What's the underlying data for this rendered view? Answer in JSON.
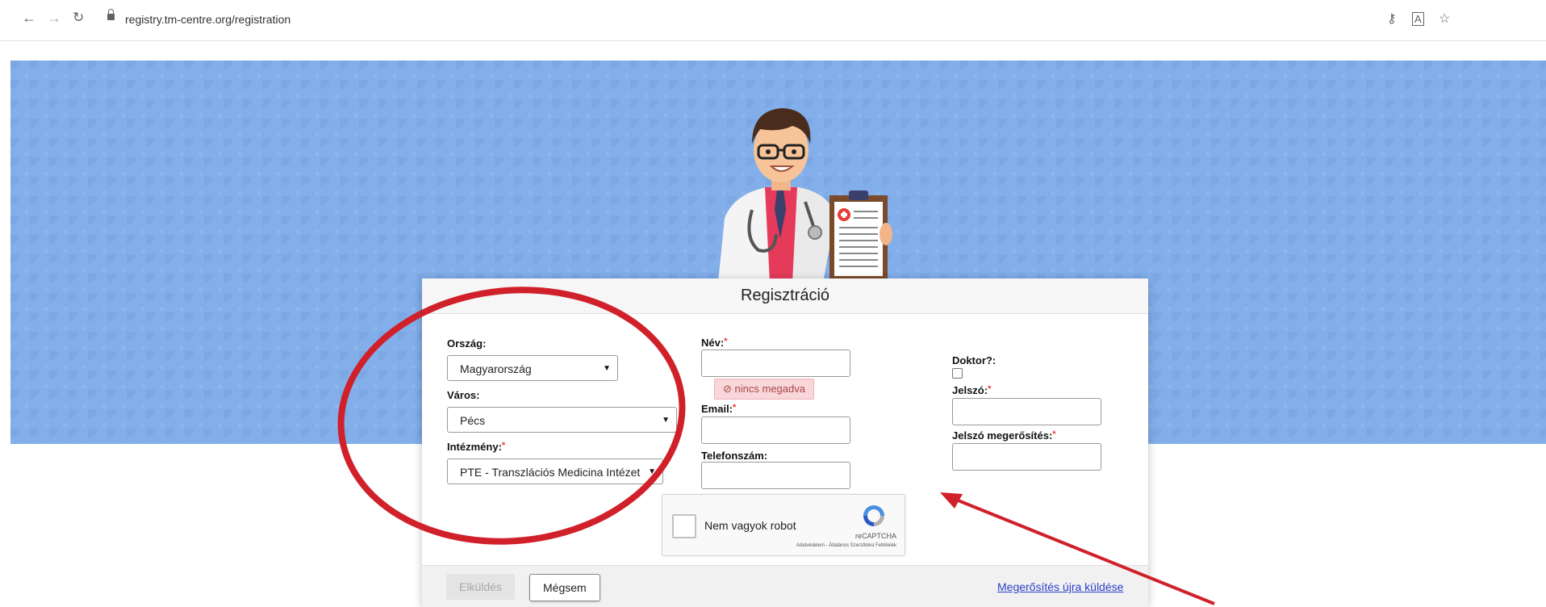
{
  "browser": {
    "url": "registry.tm-centre.org/registration",
    "back_icon": "arrow-left-icon",
    "forward_icon": "arrow-right-icon",
    "reload_icon": "reload-icon",
    "key_icon": "key-icon",
    "translate_icon": "translate-icon",
    "star_icon": "star-icon"
  },
  "colors": {
    "hero_bg": "#82aee9",
    "required": "#e53935",
    "error_bg": "#f8d7da",
    "link": "#2a3fc9",
    "annotation": "#d0202a"
  },
  "form": {
    "title": "Regisztráció",
    "country_label": "Ország:",
    "country_value": "Magyarország",
    "city_label": "Város:",
    "city_value": "Pécs",
    "institution_label": "Intézmény:",
    "institution_value": "PTE - Transzlációs Medicina Intézet",
    "required_mark": "*",
    "name_label": "Név:",
    "name_error": "nincs megadva",
    "email_label": "Email:",
    "phone_label": "Telefonszám:",
    "doctor_label": "Doktor?:",
    "password_label": "Jelszó:",
    "password_confirm_label": "Jelszó megerősítés:",
    "captcha_text": "Nem vagyok robot",
    "captcha_brand": "reCAPTCHA",
    "captcha_terms": "Adatvédelem - Általános Szerződési Feltételek"
  },
  "footer": {
    "send_label": "Elküldés",
    "cancel_label": "Mégsem",
    "resend_link": "Megerősítés újra küldése"
  }
}
